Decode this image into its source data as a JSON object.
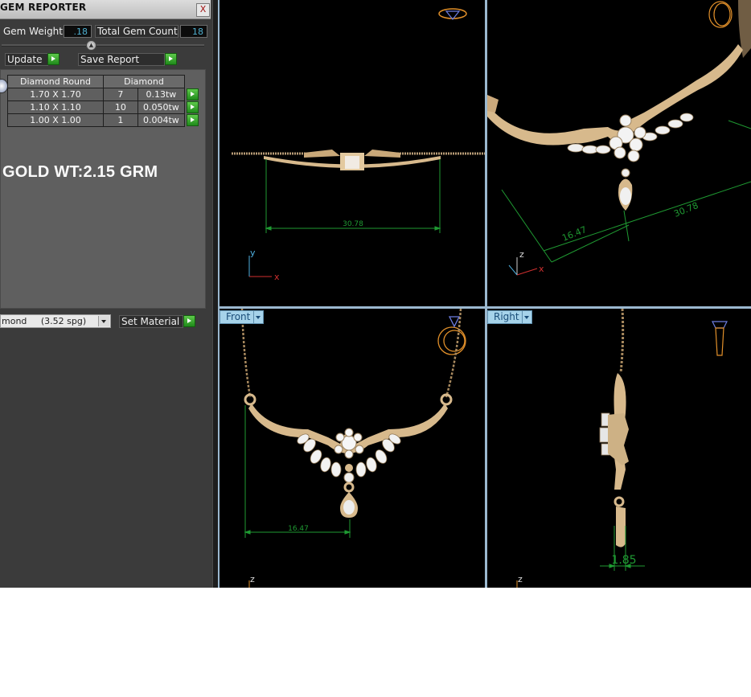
{
  "panel": {
    "title": "GEM REPORTER",
    "close_label": "X",
    "gem_weight_label": "Gem Weight",
    "gem_weight_value": ".18",
    "total_gem_count_label": "Total Gem Count",
    "total_gem_count_value": "18",
    "update_label": "Update",
    "save_report_label": "Save Report",
    "table": {
      "headers": [
        "Diamond Round",
        "Diamond"
      ],
      "rows": [
        {
          "size": "1.70 X 1.70",
          "count": "7",
          "weight": "0.13tw"
        },
        {
          "size": "1.10 X 1.10",
          "count": "10",
          "weight": "0.050tw"
        },
        {
          "size": "1.00 X 1.00",
          "count": "1",
          "weight": "0.004tw"
        }
      ]
    },
    "gold_weight_text": "GOLD WT:2.15 GRM",
    "material_dropdown_value": "mond     (3.52 spg)",
    "set_material_label": "Set Material"
  },
  "viewports": {
    "top": {
      "dimension": "30.78",
      "axis_y": "y",
      "axis_x": "x"
    },
    "perspective": {
      "dimension_long": "30.78",
      "dimension_short": "16.47",
      "axis_z": "z",
      "axis_x": "x"
    },
    "front": {
      "tab_label": "Front",
      "dimension": "16.47",
      "axis_z": "z"
    },
    "right": {
      "tab_label": "Right",
      "dimension": "1.85",
      "axis_z": "z"
    }
  },
  "colors": {
    "gold": "#d7b98c",
    "dimension_green": "#1f9a32",
    "axis_y": "#4fb0e0",
    "axis_x": "#d03030",
    "tab_bg": "#a6d3ea",
    "wire_orange": "#e2902a"
  },
  "icons": [
    "close-icon",
    "arrow-right-icon",
    "chevron-down-icon",
    "slider-knob-icon",
    "ring-wireframe-icon",
    "gem-wireframe-icon"
  ]
}
